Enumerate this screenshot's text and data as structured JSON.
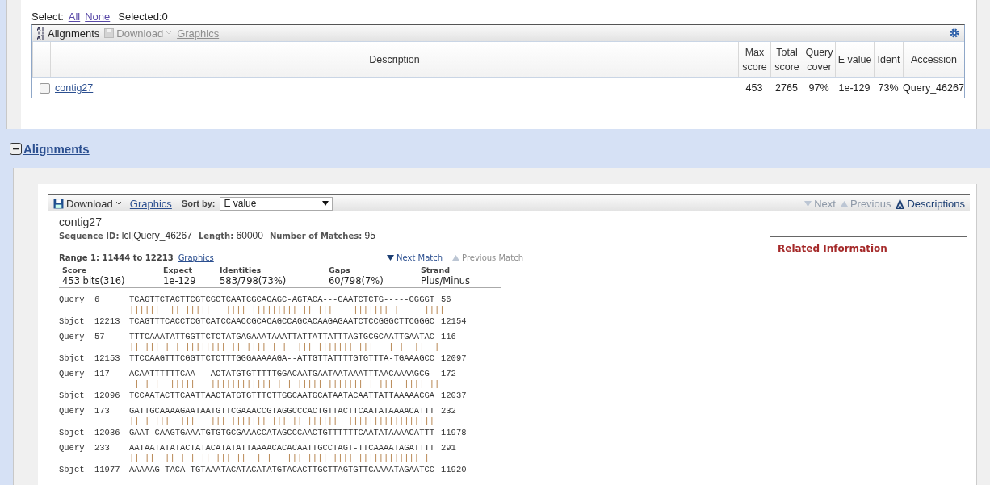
{
  "select_bar": {
    "label": "Select:",
    "links": [
      "All",
      "None"
    ],
    "selected_count": "Selected:0"
  },
  "descriptions_toolbar": {
    "items": [
      {
        "kind": "active",
        "label": "Alignments"
      },
      {
        "kind": "disabled",
        "label": "Download"
      },
      {
        "kind": "disabled-link",
        "label": "Graphics"
      }
    ]
  },
  "descriptions_table": {
    "columns": [
      {
        "label": "Description"
      },
      {
        "label": "Max score"
      },
      {
        "label": "Total score"
      },
      {
        "label": "Query cover"
      },
      {
        "label": "E value"
      },
      {
        "label": "Ident"
      },
      {
        "label": "Accession"
      }
    ],
    "rows": [
      {
        "checked": false,
        "cells": [
          "contig27",
          "453",
          "2765",
          "97%",
          "1e-129",
          "73%",
          "Query_46267"
        ]
      }
    ]
  },
  "alignments_heading": {
    "title": "Alignments",
    "expanded": true
  },
  "alignment_toolbar": {
    "download": "Download",
    "graphics": "Graphics",
    "sort_label": "Sort by:",
    "sort_value": "E value",
    "nav": [
      {
        "label": "Next",
        "disabled": true,
        "kind": "down"
      },
      {
        "label": "Previous",
        "disabled": true,
        "kind": "up"
      },
      {
        "label": "Descriptions",
        "disabled": false,
        "kind": "top"
      }
    ]
  },
  "hit": {
    "title": "contig27",
    "meta": [
      {
        "label": "Sequence ID:",
        "value": "lcl|Query_46267"
      },
      {
        "label": "Length:",
        "value": "60000"
      },
      {
        "label": "Number of Matches:",
        "value": "95"
      }
    ],
    "range": {
      "label": "Range 1: 11444 to 12213",
      "link": "Graphics",
      "next": {
        "label": "Next Match",
        "disabled": false
      },
      "previous": {
        "label": "Previous Match",
        "disabled": true
      }
    },
    "stats": [
      {
        "label": "Score",
        "value": "453 bits(316)"
      },
      {
        "label": "Expect",
        "value": "1e-129"
      },
      {
        "label": "Identities",
        "value": "583/798(73%)"
      },
      {
        "label": "Gaps",
        "value": "60/798(7%)"
      },
      {
        "label": "Strand",
        "value": "Plus/Minus"
      }
    ],
    "blocks": [
      {
        "query": {
          "label": "Query",
          "start": "6",
          "seq": "TCAGTTCTACTTCGTCGCTCAATCGCACAGC-AGTACA---GAATCTCTG-----CGGGT",
          "end": "56"
        },
        "match": "||||||  || |||||   |||| ||||||||| || |||    ||||||| |     |||| ",
        "sbjct": {
          "label": "Sbjct",
          "start": "12213",
          "seq": "TCAGTTTCACCTCGTCATCCAACCGCACAGCCAGCACAAGAGAATCTCCGGGCTTCGGGC",
          "end": "12154"
        }
      },
      {
        "query": {
          "label": "Query",
          "start": "57",
          "seq": "TTTCAAATATTGGTTCTCTATGAGAAATAAATTATTATTATTTAGTGCGCAATTGAATAC",
          "end": "116"
        },
        "match": "|| ||| | | |||||||| || |||| | |  ||| ||||||| |||   | |  ||  |",
        "sbjct": {
          "label": "Sbjct",
          "start": "12153",
          "seq": "TTCCAAGTTTCGGTTCTCTTTGGGAAAAAGA--ATTGTTATTTTGTGTTTA-TGAAAGCC",
          "end": "12097"
        }
      },
      {
        "query": {
          "label": "Query",
          "start": "117",
          "seq": "ACAATTTTTTCAA---ACTATGTGTTTTTGGACAATGAATAATAAATTTAACAAAAGCG-",
          "end": "172"
        },
        "match": " | | |  |||||   |||||||||||| | | ||||| ||||||| | |||  |||| || ",
        "sbjct": {
          "label": "Sbjct",
          "start": "12096",
          "seq": "TCCAATACTTCAATTAACTATGTGTTTCTTGGCAATGCATAATACAATTATTAAAAACGA",
          "end": "12037"
        }
      },
      {
        "query": {
          "label": "Query",
          "start": "173",
          "seq": "GATTGCAAAAGAATAATGTTCGAAACCGTAGGCCCACTGTTACTTCAATATAAAACATTT",
          "end": "232"
        },
        "match": "|| | |||  |||   ||| ||||||| ||| || ||||||  |||||||||||||||||",
        "sbjct": {
          "label": "Sbjct",
          "start": "12036",
          "seq": "GAAT-CAAGTGAAATGTGTGCGAAACCATAGCCCAACTGTTTTTTCAATATAAAACATTT",
          "end": "11978"
        }
      },
      {
        "query": {
          "label": "Query",
          "start": "233",
          "seq": "AATAATATATACTATACATATATTAAAACACACAATTGCCTAGT-TTCAAAATAGATTTT",
          "end": "291"
        },
        "match": "|| ||  || | | || ||| ||  | |   ||| |||| |||| |||||||||||| |  ",
        "sbjct": {
          "label": "Sbjct",
          "start": "11977",
          "seq": "AAAAAG-TACA-TGTAAATACATACATATGTACACTTGCTTAGTGTTCAAAATAGAATCC",
          "end": "11920"
        }
      }
    ]
  },
  "related_information": {
    "title": "Related Information"
  }
}
